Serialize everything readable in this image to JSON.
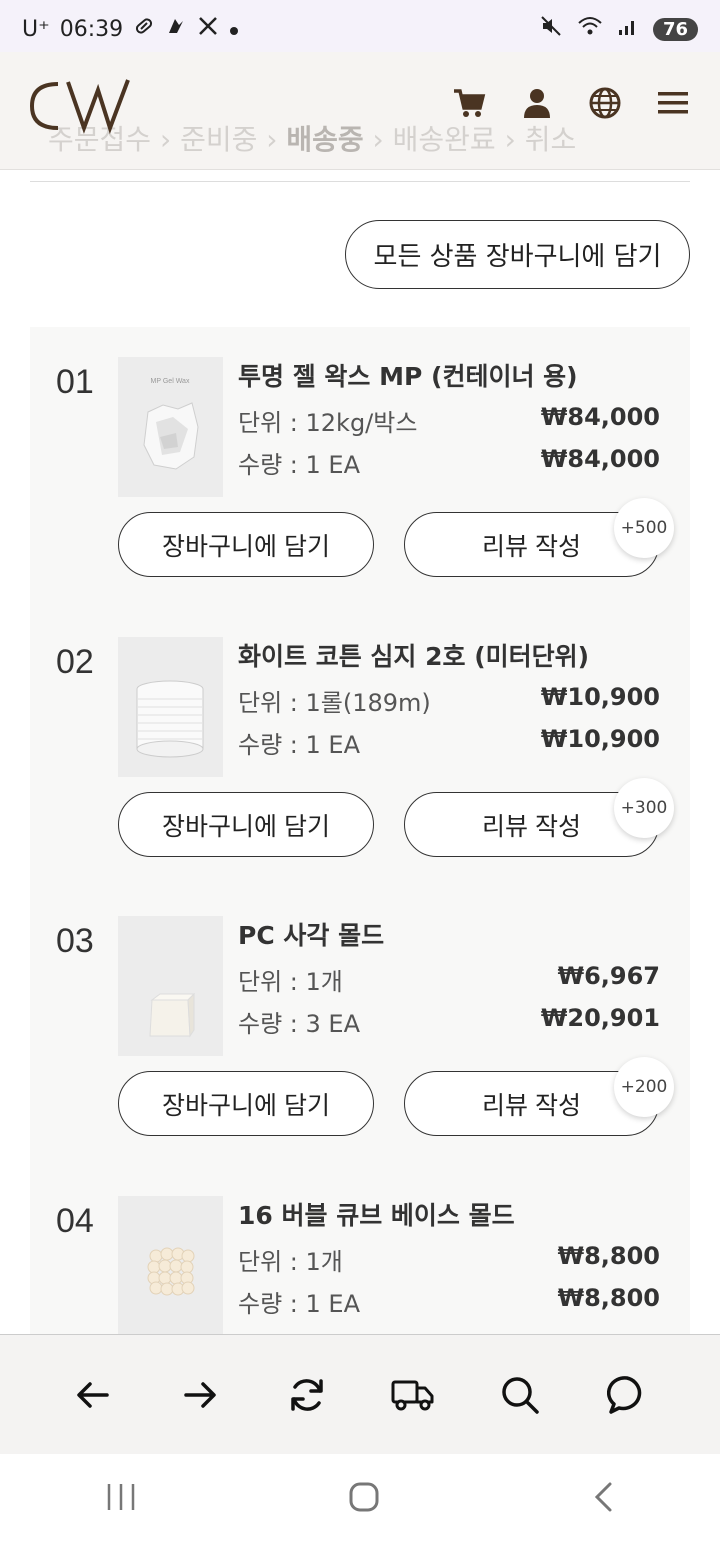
{
  "status_bar": {
    "carrier": "U⁺",
    "time": "06:39",
    "battery": "76"
  },
  "order_steps": {
    "step1": "주문접수",
    "sep": "›",
    "step2": "준비중",
    "step3": "배송중",
    "step4": "배송완료",
    "step5": "취소"
  },
  "actions": {
    "add_all_label": "모든 상품 장바구니에 담기"
  },
  "items": [
    {
      "num": "01",
      "name": "투명 젤 왁스 MP (컨테이너 용)",
      "unit_label": "단위 : 12kg/박스",
      "unit_price": "₩84,000",
      "qty_label": "수량 : 1 EA",
      "total_price": "₩84,000",
      "cart_label": "장바구니에 담기",
      "review_label": "리뷰 작성",
      "points": "+500",
      "thumb_caption": "MP Gel Wax"
    },
    {
      "num": "02",
      "name": "화이트 코튼 심지 2호 (미터단위)",
      "unit_label": "단위 : 1롤(189m)",
      "unit_price": "₩10,900",
      "qty_label": "수량 : 1 EA",
      "total_price": "₩10,900",
      "cart_label": "장바구니에 담기",
      "review_label": "리뷰 작성",
      "points": "+300"
    },
    {
      "num": "03",
      "name": "PC 사각 몰드",
      "unit_label": "단위 : 1개",
      "unit_price": "₩6,967",
      "qty_label": "수량 : 3 EA",
      "total_price": "₩20,901",
      "cart_label": "장바구니에 담기",
      "review_label": "리뷰 작성",
      "points": "+200"
    },
    {
      "num": "04",
      "name": "16 버블 큐브 베이스 몰드",
      "unit_label": "단위 : 1개",
      "unit_price": "₩8,800",
      "qty_label": "수량 : 1 EA",
      "total_price": "₩8,800"
    }
  ],
  "icons": {
    "header": [
      "cart-icon",
      "user-icon",
      "globe-icon",
      "menu-icon"
    ],
    "bottom": [
      "back-arrow-icon",
      "forward-arrow-icon",
      "refresh-icon",
      "truck-icon",
      "search-icon",
      "chat-icon"
    ]
  },
  "colors": {
    "icon_brown": "#4a3422",
    "header_bg": "#f6f4f2",
    "list_bg": "#f8f8f7"
  }
}
